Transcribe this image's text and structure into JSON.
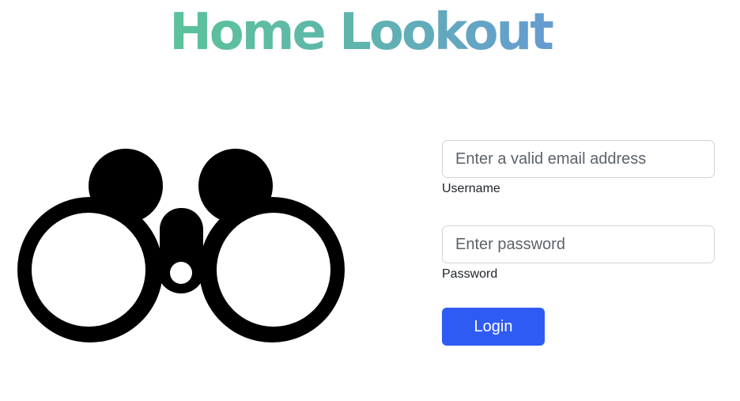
{
  "header": {
    "title": "Home Lookout"
  },
  "logo": {
    "icon": "binoculars-icon"
  },
  "login_form": {
    "email": {
      "placeholder": "Enter a valid email address",
      "value": "",
      "label": "Username"
    },
    "password": {
      "placeholder": "Enter password",
      "value": "",
      "label": "Password"
    },
    "submit_label": "Login"
  },
  "colors": {
    "title_gradient_start": "#57cc8c",
    "title_gradient_end": "#6a86f0",
    "button": "#2f5bf5"
  }
}
